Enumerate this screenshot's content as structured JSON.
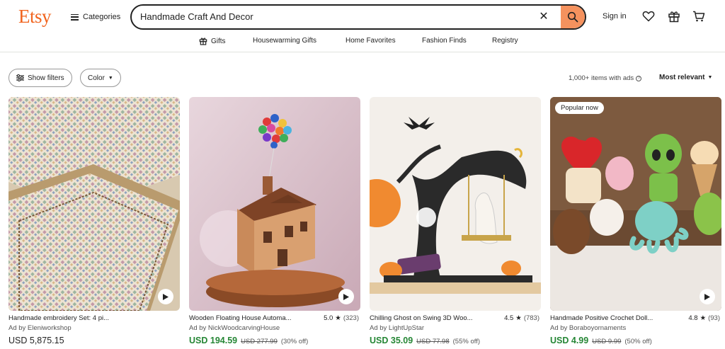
{
  "header": {
    "logo": "Etsy",
    "categories_label": "Categories",
    "search_value": "Handmade Craft And Decor",
    "signin_label": "Sign in"
  },
  "nav": {
    "items": [
      {
        "label": "Gifts",
        "icon": "gift-icon"
      },
      {
        "label": "Housewarming Gifts"
      },
      {
        "label": "Home Favorites"
      },
      {
        "label": "Fashion Finds"
      },
      {
        "label": "Registry"
      }
    ]
  },
  "filters": {
    "show_filters": "Show filters",
    "color": "Color",
    "results_count": "1,000+ items with ads",
    "sort_label": "Most relevant"
  },
  "colors": {
    "brand": "#f1641e",
    "search_button": "#f5925e",
    "sale_price": "#258635"
  },
  "products": [
    {
      "title": "Handmade embroidery Set: 4 pi...",
      "shop": "Ad by Eleniworkshop",
      "price": "USD 5,875.15",
      "rating": "",
      "reviews": "",
      "original_price": "",
      "discount": "",
      "badge": ""
    },
    {
      "title": "Wooden Floating House Automa...",
      "shop": "Ad by NickWoodcarvingHouse",
      "price": "USD 194.59",
      "rating": "5.0",
      "reviews": "(323)",
      "original_price": "USD 277.99",
      "discount": "(30% off)",
      "badge": ""
    },
    {
      "title": "Chilling Ghost on Swing 3D Woo...",
      "shop": "Ad by LightUpStar",
      "price": "USD 35.09",
      "rating": "4.5",
      "reviews": "(783)",
      "original_price": "USD 77.98",
      "discount": "(55% off)",
      "badge": ""
    },
    {
      "title": "Handmade Positive Crochet Doll...",
      "shop": "Ad by Boraboyornaments",
      "price": "USD 4.99",
      "rating": "4.8",
      "reviews": "(93)",
      "original_price": "USD 9.99",
      "discount": "(50% off)",
      "badge": "Popular now"
    }
  ]
}
